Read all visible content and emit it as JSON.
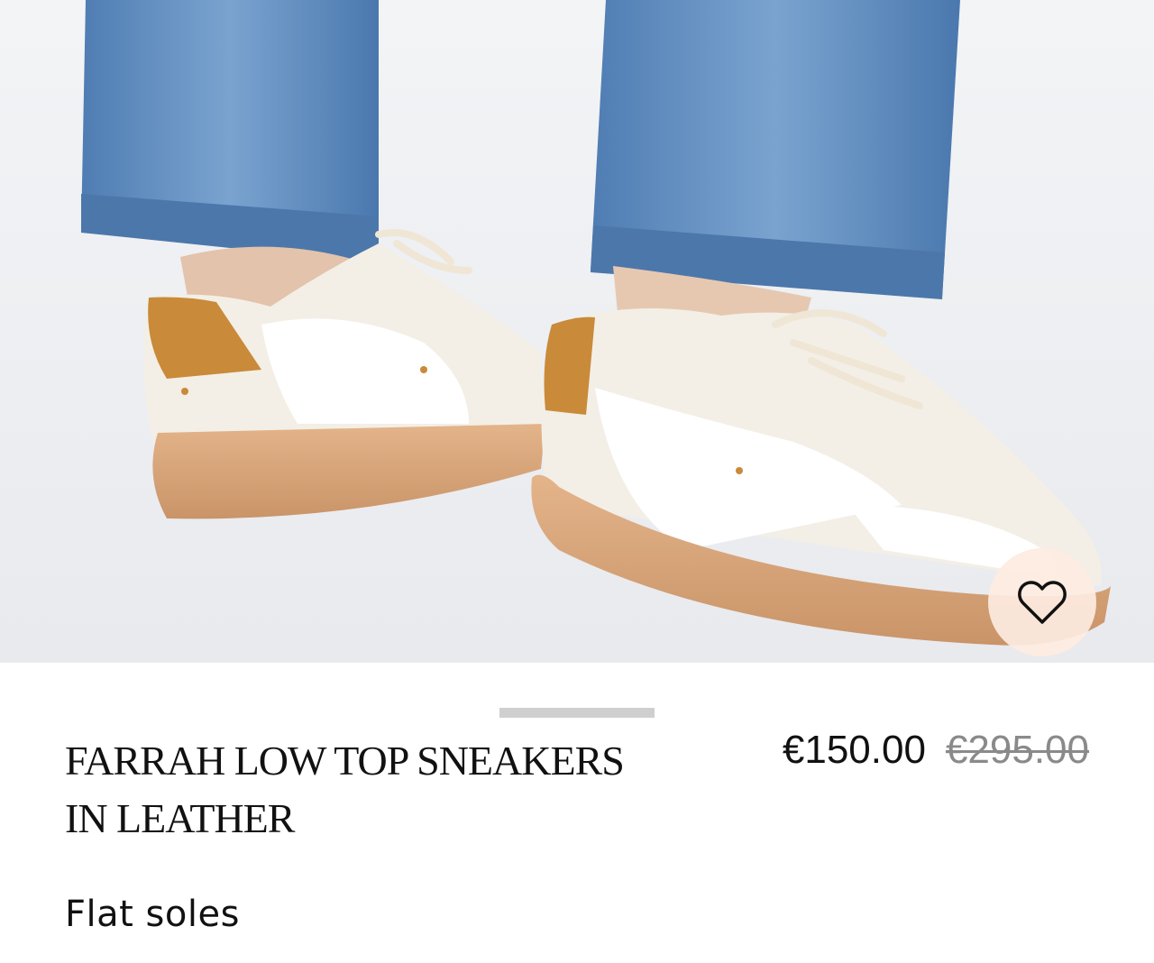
{
  "product": {
    "image_alt": "Feet in cropped blue jeans wearing off-white low top leather sneakers with tan suede heel tab and gum sole",
    "title": "FARRAH LOW TOP SNEAKERS IN LEATHER",
    "subtitle": "Flat soles",
    "price": {
      "sale": "€150.00",
      "original": "€295.00"
    }
  },
  "actions": {
    "favorite_icon": "heart-outline-icon"
  },
  "gallery": {
    "indicator": "gallery-progress-bar"
  },
  "colors": {
    "background": "#ffffff",
    "hero_background": "#eef0f3",
    "favorite_button_bg": "#fdebe1",
    "indicator": "#cfcfcf",
    "text": "#111111",
    "strikethrough_price": "#8a8a8a",
    "denim": "#5a86b8",
    "sole": "#d9a77e",
    "heel_tab": "#c98a3a"
  }
}
